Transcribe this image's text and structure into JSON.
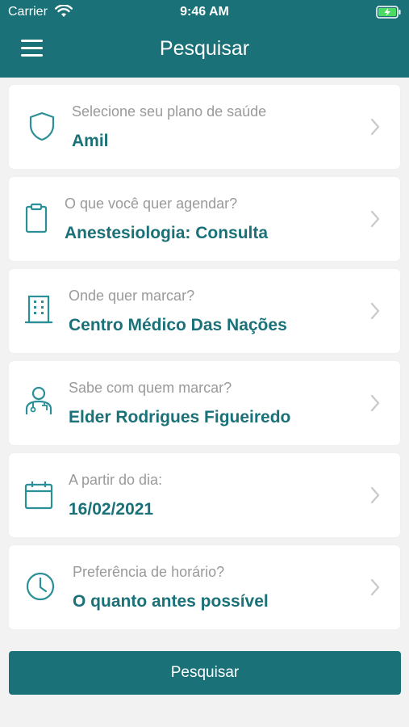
{
  "status_bar": {
    "carrier": "Carrier",
    "time": "9:46 AM",
    "wifi_icon": "wifi-icon",
    "battery_icon": "battery-charging-icon"
  },
  "header": {
    "title": "Pesquisar",
    "menu_icon": "hamburger-menu-icon",
    "background_color": "#1a7178"
  },
  "fields": [
    {
      "icon": "shield-icon",
      "label": "Selecione seu plano de saúde",
      "value": "Amil"
    },
    {
      "icon": "clipboard-icon",
      "label": "O que você quer agendar?",
      "value": "Anestesiologia: Consulta"
    },
    {
      "icon": "building-icon",
      "label": "Onde quer marcar?",
      "value": "Centro Médico Das Nações"
    },
    {
      "icon": "doctor-icon",
      "label": "Sabe com quem marcar?",
      "value": "Elder Rodrigues Figueiredo"
    },
    {
      "icon": "calendar-icon",
      "label": "A partir do dia:",
      "value": "16/02/2021"
    },
    {
      "icon": "clock-icon",
      "label": "Preferência de horário?",
      "value": "O quanto antes possível"
    }
  ],
  "search_button": {
    "label": "Pesquisar"
  },
  "colors": {
    "primary": "#1a7178",
    "label_gray": "#9a9a9a",
    "background": "#f2f2f2",
    "icon_teal": "#2a8f96"
  }
}
